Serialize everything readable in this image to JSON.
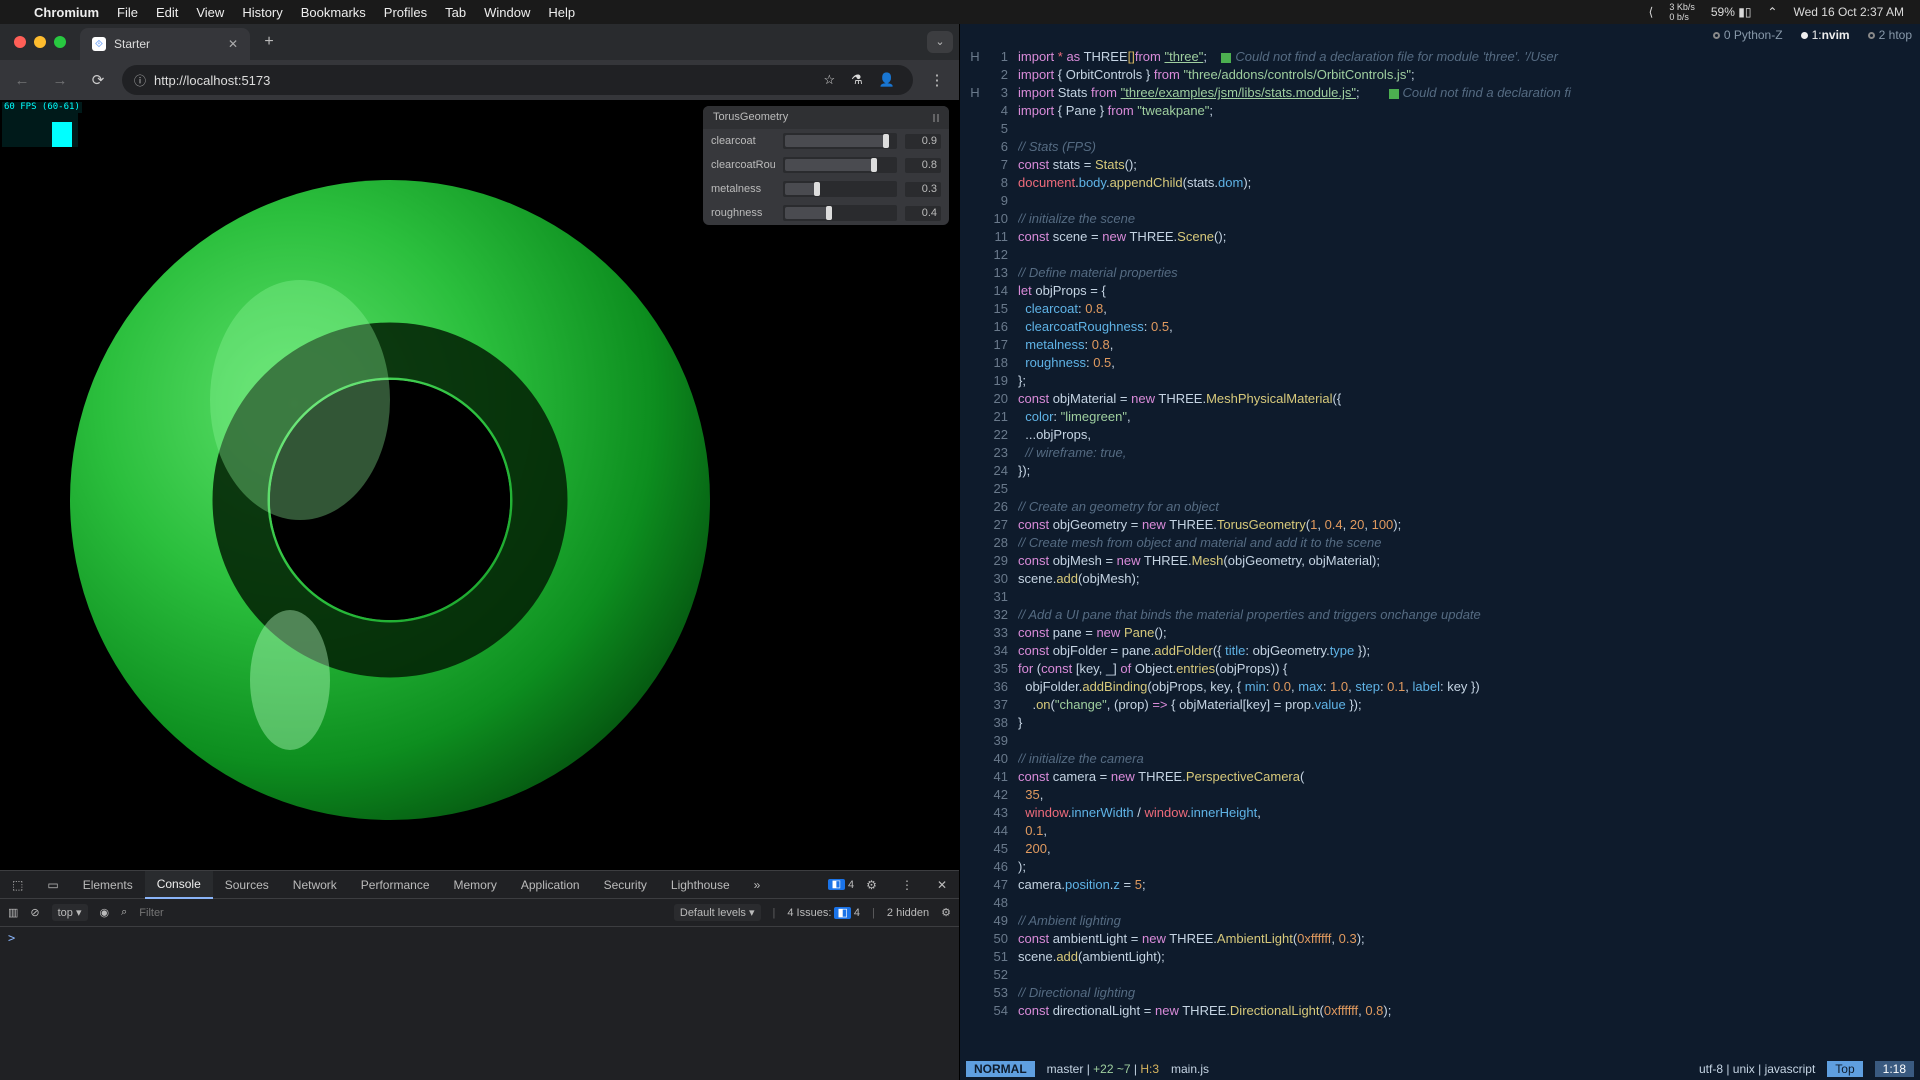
{
  "menubar": {
    "app": "Chromium",
    "items": [
      "File",
      "Edit",
      "View",
      "History",
      "Bookmarks",
      "Profiles",
      "Tab",
      "Window",
      "Help"
    ],
    "net": "3 Kb/s\n0 b/s",
    "battery": "59%",
    "clock": "Wed 16 Oct  2:37 AM"
  },
  "browser": {
    "tab_title": "Starter",
    "url": "http://localhost:5173",
    "fps": "60 FPS (60-61)",
    "pane_title": "TorusGeometry",
    "sliders": [
      {
        "label": "clearcoat",
        "value": "0.9",
        "pct": 90
      },
      {
        "label": "clearcoatRou",
        "value": "0.8",
        "pct": 80
      },
      {
        "label": "metalness",
        "value": "0.3",
        "pct": 30
      },
      {
        "label": "roughness",
        "value": "0.4",
        "pct": 40
      }
    ]
  },
  "dev": {
    "tabs": [
      "Elements",
      "Console",
      "Sources",
      "Network",
      "Performance",
      "Memory",
      "Application",
      "Security",
      "Lighthouse"
    ],
    "active": "Console",
    "badge": "4",
    "top_label": "top",
    "filter_ph": "Filter",
    "levels": "Default levels",
    "issues_label": "4 Issues:",
    "issues_count": "4",
    "hidden": "2 hidden",
    "prompt": ">"
  },
  "term": {
    "tabs": [
      {
        "i": "0",
        "t": "Python",
        "suf": "-Z"
      },
      {
        "i": "1",
        "t": "nvim",
        "active": true
      },
      {
        "i": "2",
        "t": "htop"
      }
    ]
  },
  "diag": {
    "m1": "Could not find a declaration file for module 'three'. '/User",
    "m3": "Could not find a declaration fi"
  },
  "code": [
    {
      "n": 1,
      "g": "H",
      "t": "<span class='kw'>import</span> <span class='r1'>*</span> <span class='kw'>as</span> <span class='nm'>THREE</span><span class='y1'>[]</span><span class='kw'>from</span> <span class='st und'>\"three\"</span>;    <span class='dsq'></span><span class='cm'>__D1__</span>"
    },
    {
      "n": 2,
      "t": "<span class='kw'>import</span> { <span class='nm'>OrbitControls</span> } <span class='kw'>from</span> <span class='st'>\"three/addons/controls/OrbitControls.js\"</span>;"
    },
    {
      "n": 3,
      "g": "H",
      "t": "<span class='kw'>import</span> <span class='nm'>Stats</span> <span class='kw'>from</span> <span class='st und'>\"three/examples/jsm/libs/stats.module.js\"</span>;        <span class='dsq'></span><span class='cm'>__D3__</span>"
    },
    {
      "n": 4,
      "t": "<span class='kw'>import</span> { <span class='nm'>Pane</span> } <span class='kw'>from</span> <span class='st'>\"tweakpane\"</span>;"
    },
    {
      "n": 5,
      "t": ""
    },
    {
      "n": 6,
      "t": "<span class='cm'>// Stats (FPS)</span>"
    },
    {
      "n": 7,
      "t": "<span class='kw'>const</span> <span class='nm'>stats</span> = <span class='fn'>Stats</span>();"
    },
    {
      "n": 8,
      "t": "<span class='r1'>document</span>.<span class='b1'>body</span>.<span class='fn'>appendChild</span>(<span class='nm'>stats</span>.<span class='b1'>dom</span>);"
    },
    {
      "n": 9,
      "t": ""
    },
    {
      "n": 10,
      "t": "<span class='cm'>// initialize the scene</span>"
    },
    {
      "n": 11,
      "t": "<span class='kw'>const</span> <span class='nm'>scene</span> = <span class='kw'>new</span> <span class='nm'>THREE</span>.<span class='fn'>Scene</span>();"
    },
    {
      "n": 12,
      "t": ""
    },
    {
      "n": 13,
      "t": "<span class='cm'>// Define material properties</span>"
    },
    {
      "n": 14,
      "t": "<span class='kw'>let</span> <span class='nm'>objProps</span> = {"
    },
    {
      "n": 15,
      "t": "  <span class='b1'>clearcoat</span>: <span class='o1'>0.8</span>,"
    },
    {
      "n": 16,
      "t": "  <span class='b1'>clearcoatRoughness</span>: <span class='o1'>0.5</span>,"
    },
    {
      "n": 17,
      "t": "  <span class='b1'>metalness</span>: <span class='o1'>0.8</span>,"
    },
    {
      "n": 18,
      "t": "  <span class='b1'>roughness</span>: <span class='o1'>0.5</span>,"
    },
    {
      "n": 19,
      "t": "};"
    },
    {
      "n": 20,
      "t": "<span class='kw'>const</span> <span class='nm'>objMaterial</span> = <span class='kw'>new</span> <span class='nm'>THREE</span>.<span class='fn'>MeshPhysicalMaterial</span>({"
    },
    {
      "n": 21,
      "t": "  <span class='b1'>color</span>: <span class='st'>\"limegreen\"</span>,"
    },
    {
      "n": 22,
      "t": "  ...<span class='nm'>objProps</span>,"
    },
    {
      "n": 23,
      "t": "  <span class='cm'>// wireframe: true,</span>"
    },
    {
      "n": 24,
      "t": "});"
    },
    {
      "n": 25,
      "t": ""
    },
    {
      "n": 26,
      "t": "<span class='cm'>// Create an geometry for an object</span>"
    },
    {
      "n": 27,
      "t": "<span class='kw'>const</span> <span class='nm'>objGeometry</span> = <span class='kw'>new</span> <span class='nm'>THREE</span>.<span class='fn'>TorusGeometry</span>(<span class='o1'>1</span>, <span class='o1'>0.4</span>, <span class='o1'>20</span>, <span class='o1'>100</span>);"
    },
    {
      "n": 28,
      "t": "<span class='cm'>// Create mesh from object and material and add it to the scene</span>"
    },
    {
      "n": 29,
      "t": "<span class='kw'>const</span> <span class='nm'>objMesh</span> = <span class='kw'>new</span> <span class='nm'>THREE</span>.<span class='fn'>Mesh</span>(<span class='nm'>objGeometry</span>, <span class='nm'>objMaterial</span>);"
    },
    {
      "n": 30,
      "t": "<span class='nm'>scene</span>.<span class='fn'>add</span>(<span class='nm'>objMesh</span>);"
    },
    {
      "n": 31,
      "t": ""
    },
    {
      "n": 32,
      "t": "<span class='cm'>// Add a UI pane that binds the material properties and triggers onchange update</span>"
    },
    {
      "n": 33,
      "t": "<span class='kw'>const</span> <span class='nm'>pane</span> = <span class='kw'>new</span> <span class='fn'>Pane</span>();"
    },
    {
      "n": 34,
      "t": "<span class='kw'>const</span> <span class='nm'>objFolder</span> = <span class='nm'>pane</span>.<span class='fn'>addFolder</span>({ <span class='b1'>title</span>: <span class='nm'>objGeometry</span>.<span class='b1'>type</span> });"
    },
    {
      "n": 35,
      "t": "<span class='kw'>for</span> (<span class='kw'>const</span> [<span class='nm'>key</span>, <span class='nm'>_</span>] <span class='kw'>of</span> <span class='nm'>Object</span>.<span class='fn'>entries</span>(<span class='nm'>objProps</span>)) {"
    },
    {
      "n": 36,
      "t": "  <span class='nm'>objFolder</span>.<span class='fn'>addBinding</span>(<span class='nm'>objProps</span>, <span class='nm'>key</span>, { <span class='b1'>min</span>: <span class='o1'>0.0</span>, <span class='b1'>max</span>: <span class='o1'>1.0</span>, <span class='b1'>step</span>: <span class='o1'>0.1</span>, <span class='b1'>label</span>: <span class='nm'>key</span> })"
    },
    {
      "n": 37,
      "t": "    .<span class='fn'>on</span>(<span class='st'>\"change\"</span>, (<span class='nm'>prop</span>) <span class='kw'>=&gt;</span> { <span class='nm'>objMaterial</span>[<span class='nm'>key</span>] = <span class='nm'>prop</span>.<span class='b1'>value</span> });"
    },
    {
      "n": 38,
      "t": "}"
    },
    {
      "n": 39,
      "t": ""
    },
    {
      "n": 40,
      "t": "<span class='cm'>// initialize the camera</span>"
    },
    {
      "n": 41,
      "t": "<span class='kw'>const</span> <span class='nm'>camera</span> = <span class='kw'>new</span> <span class='nm'>THREE</span>.<span class='fn'>PerspectiveCamera</span>("
    },
    {
      "n": 42,
      "t": "  <span class='o1'>35</span>,"
    },
    {
      "n": 43,
      "t": "  <span class='r1'>window</span>.<span class='b1'>innerWidth</span> / <span class='r1'>window</span>.<span class='b1'>innerHeight</span>,"
    },
    {
      "n": 44,
      "t": "  <span class='o1'>0.1</span>,"
    },
    {
      "n": 45,
      "t": "  <span class='o1'>200</span>,"
    },
    {
      "n": 46,
      "t": ");"
    },
    {
      "n": 47,
      "t": "<span class='nm'>camera</span>.<span class='b1'>position</span>.<span class='b1'>z</span> = <span class='o1'>5</span>;"
    },
    {
      "n": 48,
      "t": ""
    },
    {
      "n": 49,
      "t": "<span class='cm'>// Ambient lighting</span>"
    },
    {
      "n": 50,
      "t": "<span class='kw'>const</span> <span class='nm'>ambientLight</span> = <span class='kw'>new</span> <span class='nm'>THREE</span>.<span class='fn'>AmbientLight</span>(<span class='o1'>0xffffff</span>, <span class='o1'>0.3</span>);"
    },
    {
      "n": 51,
      "t": "<span class='nm'>scene</span>.<span class='fn'>add</span>(<span class='nm'>ambientLight</span>);"
    },
    {
      "n": 52,
      "t": ""
    },
    {
      "n": 53,
      "t": "<span class='cm'>// Directional lighting</span>"
    },
    {
      "n": 54,
      "t": "<span class='kw'>const</span> <span class='nm'>directionalLight</span> = <span class='kw'>new</span> <span class='nm'>THREE</span>.<span class='fn'>DirectionalLight</span>(<span class='o1'>0xffffff</span>, <span class='o1'>0.8</span>);"
    }
  ],
  "status": {
    "mode": "NORMAL",
    "branch": "master",
    "diff": "+22 ~7",
    "hints": "H:3",
    "file": "main.js",
    "enc": "utf-8 | unix | javascript",
    "pos_label": "Top",
    "pos": "1:18"
  }
}
